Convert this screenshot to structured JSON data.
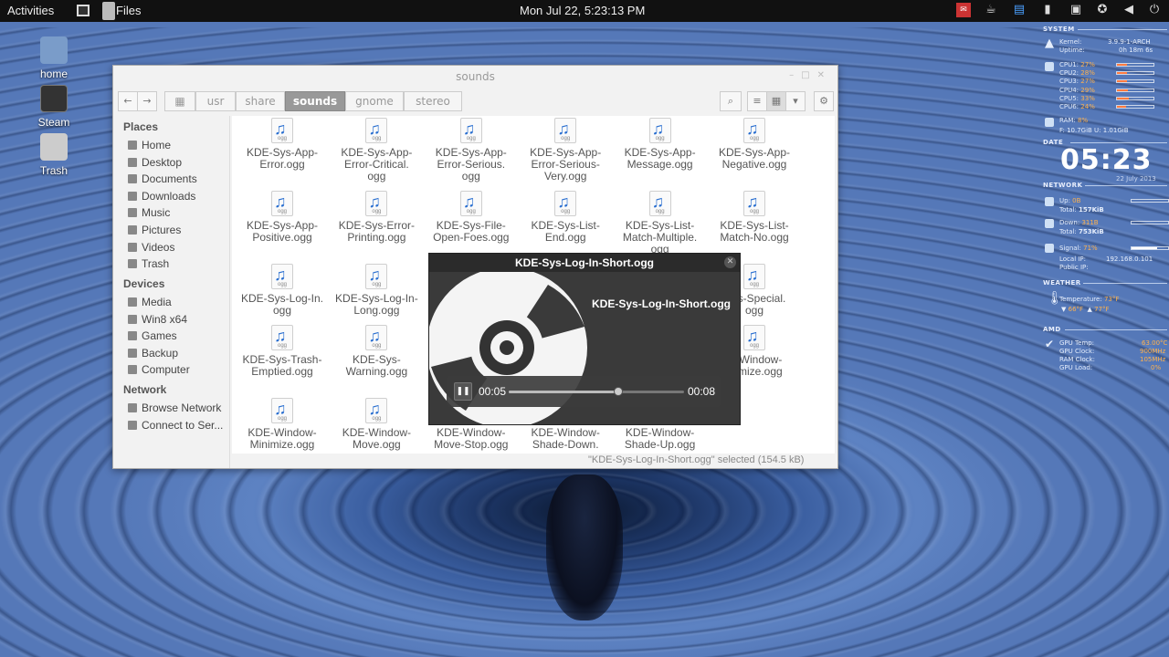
{
  "topbar": {
    "activities": "Activities",
    "app_name": "Files",
    "clock": "Mon Jul 22,  5:23:13 PM",
    "tray_icons": [
      "mail-icon",
      "coffee-icon",
      "file-icon",
      "battery-icon",
      "display-icon",
      "accessibility-icon",
      "volume-icon",
      "power-icon"
    ]
  },
  "desktop": {
    "icons": [
      {
        "label": "home",
        "icon": "home-folder-icon"
      },
      {
        "label": "Steam",
        "icon": "steam-icon"
      },
      {
        "label": "Trash",
        "icon": "trash-icon"
      }
    ]
  },
  "files_window": {
    "title": "sounds",
    "breadcrumbs": [
      "usr",
      "share",
      "sounds",
      "gnome",
      "stereo"
    ],
    "active_crumb": "sounds",
    "sidebar": {
      "places_header": "Places",
      "places": [
        "Home",
        "Desktop",
        "Documents",
        "Downloads",
        "Music",
        "Pictures",
        "Videos",
        "Trash"
      ],
      "devices_header": "Devices",
      "devices": [
        "Media",
        "Win8 x64",
        "Games",
        "Backup",
        "Computer"
      ],
      "network_header": "Network",
      "network": [
        "Browse Network",
        "Connect to Ser..."
      ]
    },
    "files": [
      [
        "KDE-Sys-App-",
        "Error.ogg",
        ""
      ],
      [
        "KDE-Sys-App-",
        "Error-Critical.",
        "ogg"
      ],
      [
        "KDE-Sys-App-",
        "Error-Serious.",
        "ogg"
      ],
      [
        "KDE-Sys-App-",
        "Error-Serious-",
        "Very.ogg"
      ],
      [
        "KDE-Sys-App-",
        "Message.ogg",
        ""
      ],
      [
        "KDE-Sys-App-",
        "Negative.ogg",
        ""
      ],
      [
        "KDE-Sys-App-",
        "Positive.ogg",
        ""
      ],
      [
        "KDE-Sys-Error-",
        "Printing.ogg",
        ""
      ],
      [
        "KDE-Sys-File-",
        "Open-Foes.ogg",
        ""
      ],
      [
        "KDE-Sys-List-",
        "End.ogg",
        ""
      ],
      [
        "KDE-Sys-List-",
        "Match-Multiple.",
        "ogg"
      ],
      [
        "KDE-Sys-List-",
        "Match-No.ogg",
        ""
      ],
      [
        "KDE-Sys-Log-In.",
        "ogg",
        ""
      ],
      [
        "KDE-Sys-Log-In-",
        "Long.ogg",
        ""
      ],
      [
        "",
        "",
        ""
      ],
      [
        "",
        "",
        ""
      ],
      [
        "",
        "",
        ""
      ],
      [
        "...ys-Special.",
        "ogg",
        ""
      ],
      [
        "KDE-Sys-Trash-",
        "Emptied.ogg",
        ""
      ],
      [
        "KDE-Sys-",
        "Warning.ogg",
        ""
      ],
      [
        "",
        "",
        ""
      ],
      [
        "",
        "",
        ""
      ],
      [
        "",
        "",
        ""
      ],
      [
        "...-Window-",
        "...imize.ogg",
        ""
      ],
      [
        "KDE-Window-",
        "Minimize.ogg",
        ""
      ],
      [
        "KDE-Window-",
        "Move.ogg",
        ""
      ],
      [
        "KDE-Window-",
        "Move-Stop.ogg",
        ""
      ],
      [
        "KDE-Window-",
        "Shade-Down.",
        "ogg"
      ],
      [
        "KDE-Window-",
        "Shade-Up.ogg",
        ""
      ],
      [
        "",
        "",
        ""
      ]
    ],
    "status": "\"KDE-Sys-Log-In-Short.ogg\" selected (154.5 kB)"
  },
  "player": {
    "title": "KDE-Sys-Log-In-Short.ogg",
    "track_name": "KDE-Sys-Log-In-Short.ogg",
    "current_time": "00:05",
    "total_time": "00:08",
    "progress": 0.625
  },
  "conky": {
    "system_header": "SYSTEM",
    "kernel_label": "Kernel:",
    "kernel_value": "3.9.9-1-ARCH",
    "uptime_label": "Uptime:",
    "uptime_value": "0h 18m 6s",
    "cpus": [
      {
        "label": "CPU1:",
        "value": "27%",
        "fraction": 0.27
      },
      {
        "label": "CPU2:",
        "value": "28%",
        "fraction": 0.28
      },
      {
        "label": "CPU3:",
        "value": "27%",
        "fraction": 0.27
      },
      {
        "label": "CPU4:",
        "value": "29%",
        "fraction": 0.29
      },
      {
        "label": "CPU5:",
        "value": "33%",
        "fraction": 0.33
      },
      {
        "label": "CPU6:",
        "value": "24%",
        "fraction": 0.24
      }
    ],
    "ram_label": "RAM:",
    "ram_value": "8%",
    "disk_text": "F: 10.7GiB U: 1.01GiB",
    "date_header": "DATE",
    "time": "05:23",
    "date": "22 July 2013",
    "network_header": "NETWORK",
    "up_label": "Up:",
    "up_value": "0B",
    "up_total_label": "Total:",
    "up_total": "157KiB",
    "down_label": "Down:",
    "down_value": "311B",
    "down_total_label": "Total:",
    "down_total": "753KiB",
    "signal_label": "Signal:",
    "signal_value": "71%",
    "signal_fraction": 0.71,
    "local_ip_label": "Local IP:",
    "local_ip": "192.168.0.101",
    "public_ip_label": "Public IP:",
    "weather_header": "WEATHER",
    "temp_label": "Temperature:",
    "temp_value": "73°F",
    "low": "66°F",
    "high": "77°F",
    "amd_header": "AMD",
    "gpu_temp_label": "GPU Temp:",
    "gpu_temp": "63.00°C",
    "gpu_clock_label": "GPU Clock:",
    "gpu_clock": "900MHz",
    "ram_clock_label": "RAM Clock:",
    "ram_clock": "105MHz",
    "gpu_load_label": "GPU Load:",
    "gpu_load": "0%"
  },
  "colors": {
    "accent_orange": "#ffb24d",
    "music_note_blue": "#2a6fd0"
  }
}
